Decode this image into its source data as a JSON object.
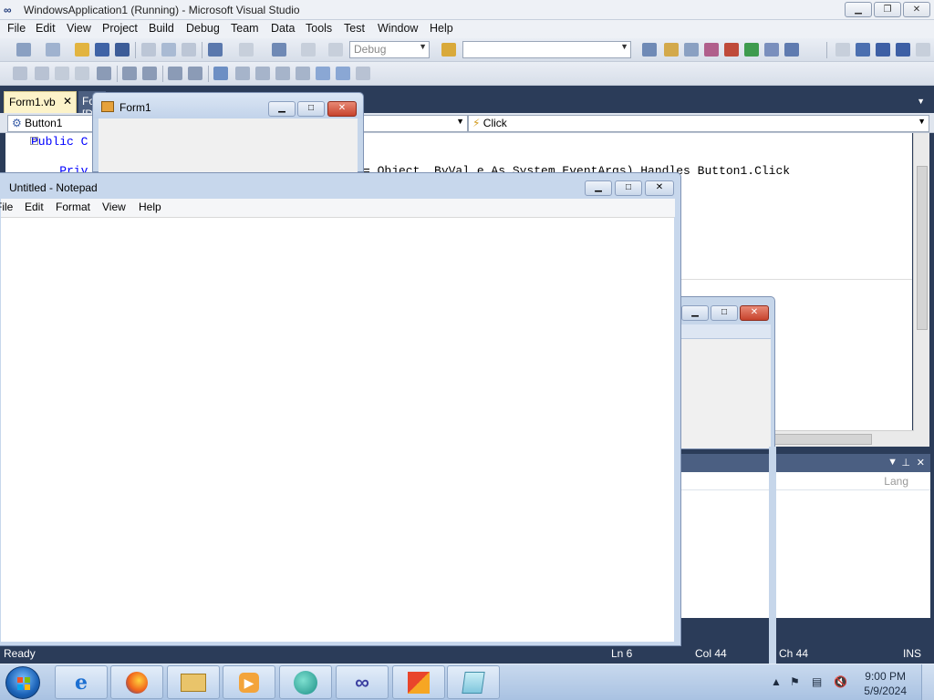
{
  "vs": {
    "title": "WindowsApplication1 (Running) - Microsoft Visual Studio",
    "menu": [
      "File",
      "Edit",
      "View",
      "Project",
      "Build",
      "Debug",
      "Team",
      "Data",
      "Tools",
      "Test",
      "Window",
      "Help"
    ],
    "config_combo": "Debug",
    "tabs": {
      "code_tab": "Form1.vb",
      "design_tab": "Form1.vb [Design]"
    },
    "nav": {
      "object": "Button1",
      "event": "Click"
    },
    "code": [
      "Public C",
      "    Priv",
      "= Object, ByVal e As System.EventArgs) Handles Button1.Click"
    ],
    "bottom_panel": {
      "lang_col": "Lang"
    },
    "status": {
      "ready": "Ready",
      "ln": "Ln 6",
      "col": "Col 44",
      "ch": "Ch 44",
      "ins": "INS"
    },
    "accent": "#2b3c59"
  },
  "form1": {
    "title": "Form1"
  },
  "notepad": {
    "title": "Untitled - Notepad",
    "menu": [
      "File",
      "Edit",
      "Format",
      "View",
      "Help"
    ],
    "content": ""
  },
  "taskbar": {
    "apps": [
      "internet-explorer-icon",
      "firefox-icon",
      "file-explorer-icon",
      "media-player-icon",
      "chat-icon",
      "visual-studio-icon",
      "office-icon",
      "notepad-icon"
    ],
    "clock_time": "9:00 PM",
    "clock_date": "5/9/2024"
  }
}
